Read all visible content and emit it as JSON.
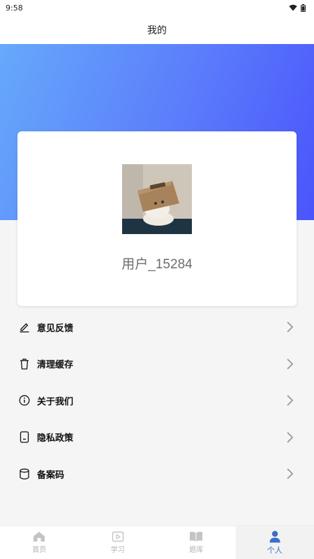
{
  "status_bar": {
    "time": "9:58"
  },
  "header": {
    "title": "我的"
  },
  "profile": {
    "username": "用户_15284"
  },
  "menu": [
    {
      "label": "意见反馈",
      "icon": "pencil-icon"
    },
    {
      "label": "清理缓存",
      "icon": "trash-icon"
    },
    {
      "label": "关于我们",
      "icon": "info-icon"
    },
    {
      "label": "隐私政策",
      "icon": "document-icon"
    },
    {
      "label": "备案码",
      "icon": "database-icon"
    }
  ],
  "tabs": [
    {
      "label": "首页",
      "icon": "home-icon",
      "active": false
    },
    {
      "label": "学习",
      "icon": "video-icon",
      "active": false
    },
    {
      "label": "题库",
      "icon": "book-icon",
      "active": false
    },
    {
      "label": "个人",
      "icon": "person-icon",
      "active": true
    }
  ],
  "colors": {
    "accent": "#3a6fc8",
    "gradient_start": "#66a9fb",
    "gradient_end": "#4a55fb"
  }
}
